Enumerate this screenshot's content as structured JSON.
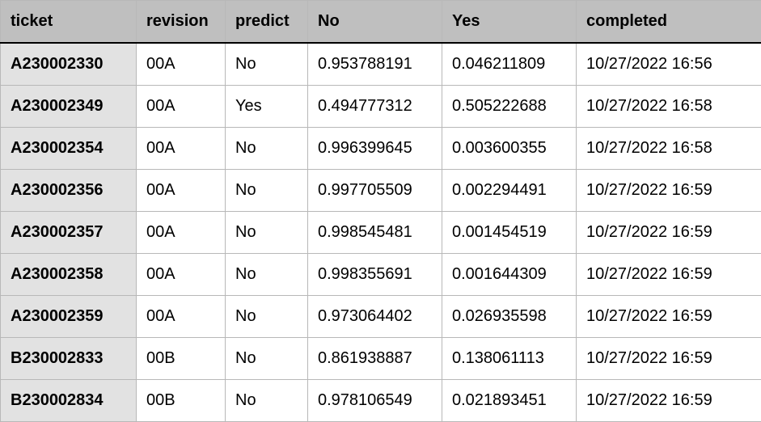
{
  "columns": [
    "ticket",
    "revision",
    "predict",
    "No",
    "Yes",
    "completed"
  ],
  "rows": [
    {
      "ticket": "A230002330",
      "revision": "00A",
      "predict": "No",
      "no": "0.953788191",
      "yes": "0.046211809",
      "completed": "10/27/2022 16:56"
    },
    {
      "ticket": "A230002349",
      "revision": "00A",
      "predict": "Yes",
      "no": "0.494777312",
      "yes": "0.505222688",
      "completed": "10/27/2022 16:58"
    },
    {
      "ticket": "A230002354",
      "revision": "00A",
      "predict": "No",
      "no": "0.996399645",
      "yes": "0.003600355",
      "completed": "10/27/2022 16:58"
    },
    {
      "ticket": "A230002356",
      "revision": "00A",
      "predict": "No",
      "no": "0.997705509",
      "yes": "0.002294491",
      "completed": "10/27/2022 16:59"
    },
    {
      "ticket": "A230002357",
      "revision": "00A",
      "predict": "No",
      "no": "0.998545481",
      "yes": "0.001454519",
      "completed": "10/27/2022 16:59"
    },
    {
      "ticket": "A230002358",
      "revision": "00A",
      "predict": "No",
      "no": "0.998355691",
      "yes": "0.001644309",
      "completed": "10/27/2022 16:59"
    },
    {
      "ticket": "A230002359",
      "revision": "00A",
      "predict": "No",
      "no": "0.973064402",
      "yes": "0.026935598",
      "completed": "10/27/2022 16:59"
    },
    {
      "ticket": "B230002833",
      "revision": "00B",
      "predict": "No",
      "no": "0.861938887",
      "yes": "0.138061113",
      "completed": "10/27/2022 16:59"
    },
    {
      "ticket": "B230002834",
      "revision": "00B",
      "predict": "No",
      "no": "0.978106549",
      "yes": "0.021893451",
      "completed": "10/27/2022 16:59"
    }
  ]
}
